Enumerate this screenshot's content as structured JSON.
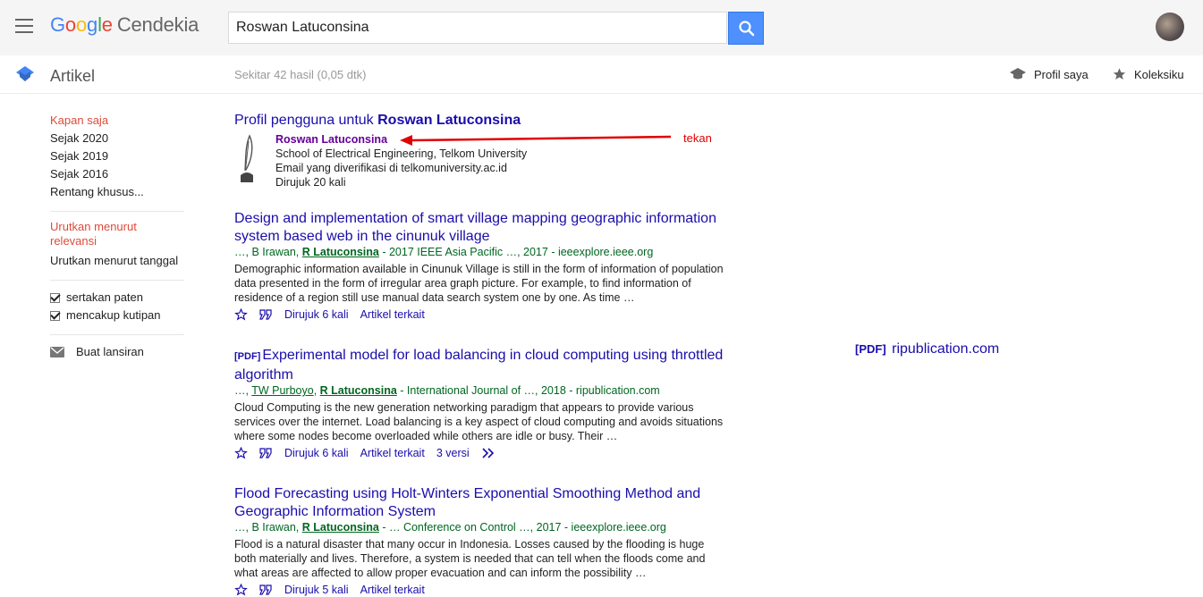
{
  "header": {
    "logo_google": "Google",
    "logo_product": "Cendekia",
    "search_value": "Roswan Latuconsina"
  },
  "subbar": {
    "section_label": "Artikel",
    "result_count": "Sekitar 42 hasil (0,05 dtk)",
    "profile_link": "Profil saya",
    "collection_link": "Koleksiku"
  },
  "sidebar": {
    "time_filters": [
      "Kapan saja",
      "Sejak 2020",
      "Sejak 2019",
      "Sejak 2016",
      "Rentang khusus..."
    ],
    "sort_relevance": "Urutkan menurut relevansi",
    "sort_date": "Urutkan menurut tanggal",
    "include_patents": "sertakan paten",
    "include_citations": "mencakup kutipan",
    "create_alert": "Buat lansiran"
  },
  "profile": {
    "title_prefix": "Profil pengguna untuk ",
    "title_name": "Roswan Latuconsina",
    "name": "Roswan Latuconsina",
    "affiliation": "School of Electrical Engineering, Telkom University",
    "email": "Email yang diverifikasi di telkomuniversity.ac.id",
    "cited": "Dirujuk 20 kali"
  },
  "annotation": {
    "label": "tekan"
  },
  "results": [
    {
      "pdf": "",
      "title_line1": "Design and implementation of smart village mapping geographic information",
      "title_line2": "system based web in the cinunuk village",
      "meta_prefix": "…, B Irawan, ",
      "meta_author": "R Latuconsina",
      "meta_suffix": " - 2017 IEEE Asia Pacific …, 2017 - ieeexplore.ieee.org",
      "snippet": "Demographic information available in Cinunuk Village is still in the form of information of population data presented in the form of irregular area graph picture. For example, to find information of residence of a region still use manual data search system one by one. As time …",
      "cited": "Dirujuk 6 kali",
      "related": "Artikel terkait",
      "versions": ""
    },
    {
      "pdf": "[PDF]",
      "title_line1": "Experimental model for load balancing in cloud computing using throttled",
      "title_line2": "algorithm",
      "meta_prefix": "…, ",
      "meta_author0": "TW Purboyo",
      "meta_sep": ", ",
      "meta_author": "R Latuconsina",
      "meta_suffix": " - International Journal of …, 2018 - ripublication.com",
      "snippet": "Cloud Computing is the new generation networking paradigm that appears to provide various services over the internet. Load balancing is a key aspect of cloud computing and avoids situations where some nodes become overloaded while others are idle or busy. Their …",
      "cited": "Dirujuk 6 kali",
      "related": "Artikel terkait",
      "versions": "3 versi"
    },
    {
      "pdf": "",
      "title_line1": "Flood Forecasting using Holt-Winters Exponential Smoothing Method and",
      "title_line2": "Geographic Information System",
      "meta_prefix": "…, B Irawan, ",
      "meta_author": "R Latuconsina",
      "meta_suffix": " - … Conference on Control …, 2017 - ieeexplore.ieee.org",
      "snippet": "Flood is a natural disaster that many occur in Indonesia. Losses caused by the flooding is huge both materially and lives. Therefore, a system is needed that can tell when the floods come and what areas are affected to allow proper evacuation and can inform the possibility …",
      "cited": "Dirujuk 5 kali",
      "related": "Artikel terkait",
      "versions": ""
    }
  ],
  "side_pdf": {
    "tag": "[PDF]",
    "domain": "ripublication.com"
  },
  "icons": {
    "menu": "hamburger-icon",
    "search": "search-icon",
    "articles": "scholar-cap-icon",
    "profile": "graduation-cap-icon",
    "collection": "star-icon",
    "alert": "mail-icon",
    "save": "star-outline-icon",
    "cite": "quote-icon",
    "more": "double-chevron-icon",
    "profile_photo": "quill-icon"
  },
  "colors": {
    "link": "#1a0dab",
    "visited": "#660099",
    "meta_green": "#006621",
    "active_red": "#dd4b39",
    "search_blue": "#4d90fe",
    "annotation_red": "#e00000"
  }
}
